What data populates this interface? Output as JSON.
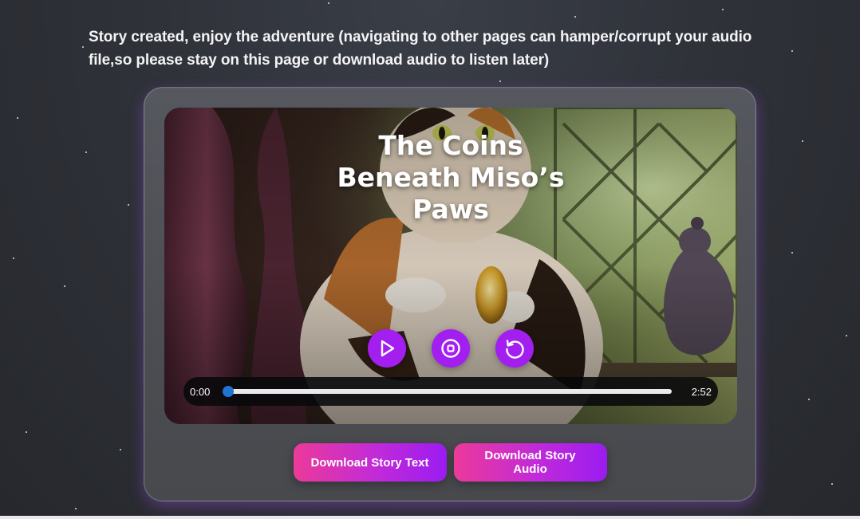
{
  "notice": "Story created, enjoy the adventure (navigating to other pages can hamper/corrupt your audio file,so please stay on this page or download audio to listen later)",
  "story": {
    "title": "The Coins Beneath Miso’s Paws",
    "image_description": "calico-cat-holding-gold-coin-by-window"
  },
  "player": {
    "controls": [
      {
        "name": "play-icon",
        "label": "Play"
      },
      {
        "name": "stop-icon",
        "label": "Stop"
      },
      {
        "name": "restart-icon",
        "label": "Restart"
      }
    ],
    "current_time": "0:00",
    "duration": "2:52",
    "progress": 0
  },
  "actions": {
    "download_text": "Download Story Text",
    "download_audio": "Download Story Audio"
  },
  "colors": {
    "accent": "#a21ff0",
    "button_gradient_start": "#ec3a9a",
    "button_gradient_end": "#9b1cf0",
    "slider_thumb": "#1f74d2"
  }
}
